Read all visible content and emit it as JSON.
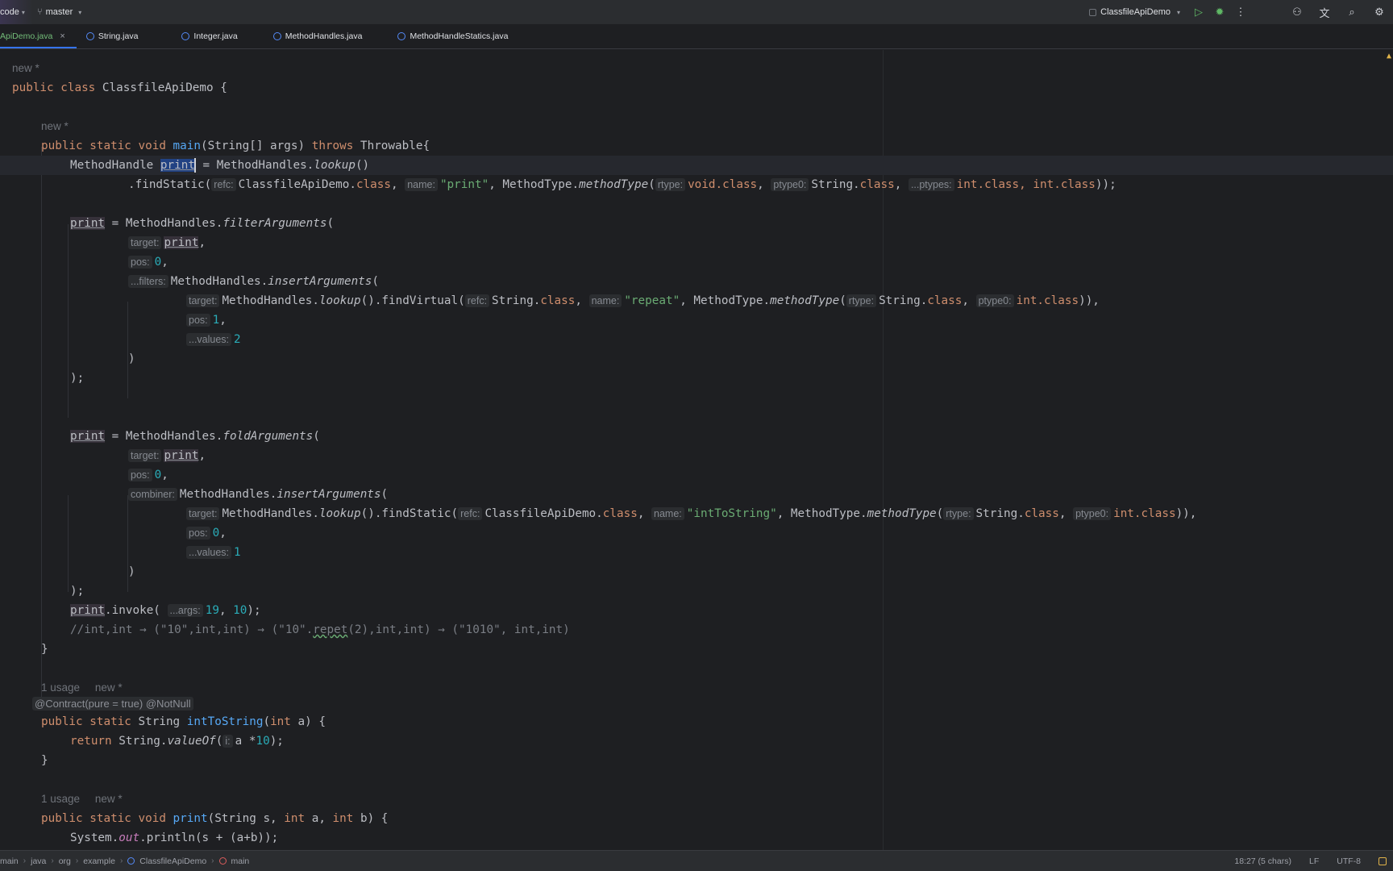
{
  "titlebar": {
    "project": "code",
    "branch": "master",
    "run_config": "ClassfileApiDemo",
    "icons": [
      "run-icon",
      "debug-icon",
      "more-icon",
      "add-user-icon",
      "translate-icon",
      "search-icon",
      "settings-icon"
    ]
  },
  "tabs": [
    {
      "label": "ApiDemo.java",
      "active": true
    },
    {
      "label": "String.java"
    },
    {
      "label": "Integer.java"
    },
    {
      "label": "MethodHandles.java"
    },
    {
      "label": "MethodHandleStatics.java"
    }
  ],
  "code": {
    "l1": "new *",
    "l2_kw": "public class",
    "l2_name": "ClassfileApiDemo",
    "l2_end": " {",
    "l3": "new *",
    "l4_kw1": "public static void",
    "l4_fn": "main",
    "l4_mid": "(String[] args) ",
    "l4_kw2": "throws",
    "l4_end": " Throwable{",
    "l5_a": "MethodHandle ",
    "l5_sel": "print",
    "l5_b": " = MethodHandles.",
    "l5_it": "lookup",
    "l5_c": "()",
    "l6_a": ".findStatic(",
    "l6_h1": "refc:",
    "l6_b": "ClassfileApiDemo.",
    "l6_kw1": "class",
    "l6_c": ", ",
    "l6_h2": "name:",
    "l6_s": "\"print\"",
    "l6_d": ", MethodType.",
    "l6_it": "methodType",
    "l6_e": "(",
    "l6_h3": "rtype:",
    "l6_f": "void.",
    "l6_kw2": "class",
    "l6_g": ", ",
    "l6_h4": "ptype0:",
    "l6_h": "String.",
    "l6_kw3": "class",
    "l6_i": ", ",
    "l6_h5": "...ptypes:",
    "l6_j": "int.",
    "l6_kw4": "class",
    "l6_k": ", int.",
    "l6_kw5": "class",
    "l6_l": "));",
    "l8_var": "print",
    "l8_a": " = MethodHandles.",
    "l8_it": "filterArguments",
    "l8_b": "(",
    "l9_h": "target:",
    "l9_var": "print",
    "l9_b": ",",
    "l10_h": "pos:",
    "l10_n": "0",
    "l10_b": ",",
    "l11_h": "...filters:",
    "l11_a": "MethodHandles.",
    "l11_it": "insertArguments",
    "l11_b": "(",
    "l12_h1": "target:",
    "l12_a": "MethodHandles.",
    "l12_it1": "lookup",
    "l12_b": "().findVirtual(",
    "l12_h2": "refc:",
    "l12_c": "String.",
    "l12_kw1": "class",
    "l12_d": ", ",
    "l12_h3": "name:",
    "l12_s": "\"repeat\"",
    "l12_e": ", MethodType.",
    "l12_it2": "methodType",
    "l12_f": "(",
    "l12_h4": "rtype:",
    "l12_g": "String.",
    "l12_kw2": "class",
    "l12_h": ", ",
    "l12_h5": "ptype0:",
    "l12_i": "int.",
    "l12_kw3": "class",
    "l12_j": ")),",
    "l13_h": "pos:",
    "l13_n": "1",
    "l13_b": ",",
    "l14_h": "...values:",
    "l14_n": "2",
    "l15": ")",
    "l16": ");",
    "l19_var": "print",
    "l19_a": " = MethodHandles.",
    "l19_it": "foldArguments",
    "l19_b": "(",
    "l20_h": "target:",
    "l20_var": "print",
    "l20_b": ",",
    "l21_h": "pos:",
    "l21_n": "0",
    "l21_b": ",",
    "l22_h": "combiner:",
    "l22_a": "MethodHandles.",
    "l22_it": "insertArguments",
    "l22_b": "(",
    "l23_h1": "target:",
    "l23_a": "MethodHandles.",
    "l23_it1": "lookup",
    "l23_b": "().findStatic(",
    "l23_h2": "refc:",
    "l23_c": "ClassfileApiDemo.",
    "l23_kw1": "class",
    "l23_d": ", ",
    "l23_h3": "name:",
    "l23_s": "\"intToString\"",
    "l23_e": ", MethodType.",
    "l23_it2": "methodType",
    "l23_f": "(",
    "l23_h4": "rtype:",
    "l23_g": "String.",
    "l23_kw2": "class",
    "l23_h": ", ",
    "l23_h5": "ptype0:",
    "l23_i": "int.",
    "l23_kw3": "class",
    "l23_j": ")),",
    "l24_h": "pos:",
    "l24_n": "0",
    "l24_b": ",",
    "l25_h": "...values:",
    "l25_n": "1",
    "l26": ")",
    "l27": ");",
    "l28_var": "print",
    "l28_a": ".invoke( ",
    "l28_h": "...args:",
    "l28_n1": "19",
    "l28_b": ", ",
    "l28_n2": "10",
    "l28_c": ");",
    "l29_a": "//int,int → (\"10\",int,int) → (\"10\".",
    "l29_w": "repet",
    "l29_b": "(2),int,int) → (\"1010\", int,int)",
    "l30": "}",
    "l32_usage": "1 usage",
    "l32_new": "new *",
    "l33_a1": "@Contract(pure = true)",
    "l33_a2": "@NotNull",
    "l34_kw": "public static",
    "l34_a": " String ",
    "l34_fn": "intToString",
    "l34_b": "(",
    "l34_kw2": "int",
    "l34_c": " a) {",
    "l35_kw": "return",
    "l35_a": " String.",
    "l35_it": "valueOf",
    "l35_b": "(",
    "l35_h": "i:",
    "l35_c": "a *",
    "l35_n": "10",
    "l35_d": ");",
    "l36": "}",
    "l38_usage": "1 usage",
    "l38_new": "new *",
    "l39_kw": "public static void",
    "l39_fn": "print",
    "l39_a": "(String s, ",
    "l39_kw2": "int",
    "l39_b": " a, ",
    "l39_kw3": "int",
    "l39_c": " b) {",
    "l40_a": "System.",
    "l40_stat": "out",
    "l40_b": ".println(s + (a+b));"
  },
  "statusbar": {
    "crumbs": [
      "main",
      "java",
      "org",
      "example",
      "ClassfileApiDemo",
      "main"
    ],
    "position": "18:27 (5 chars)",
    "line_sep": "LF",
    "encoding": "UTF-8"
  },
  "colors": {
    "accent": "#3574f0",
    "keyword": "#cf8e6d",
    "string": "#6aab73",
    "number": "#2aacb8",
    "function": "#56a8f5"
  }
}
